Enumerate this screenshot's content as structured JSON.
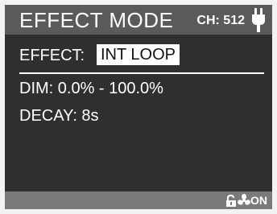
{
  "header": {
    "title": "EFFECT MODE",
    "channel": "CH: 512",
    "icon": "plug-icon"
  },
  "effect": {
    "label": "EFFECT:",
    "value": "INT LOOP"
  },
  "dim": {
    "text": "DIM: 0.0% - 100.0%"
  },
  "decay": {
    "text": "DECAY: 8s"
  },
  "footer": {
    "icons": [
      "unlock-icon",
      "fan-icon"
    ],
    "status": "ON"
  },
  "colors": {
    "screen_background": "#2f2f2f",
    "header_background": "#5a5a5a",
    "footer_background": "#7a7a7a",
    "text": "#ffffff",
    "highlight_background": "#ffffff",
    "highlight_text": "#111111"
  }
}
